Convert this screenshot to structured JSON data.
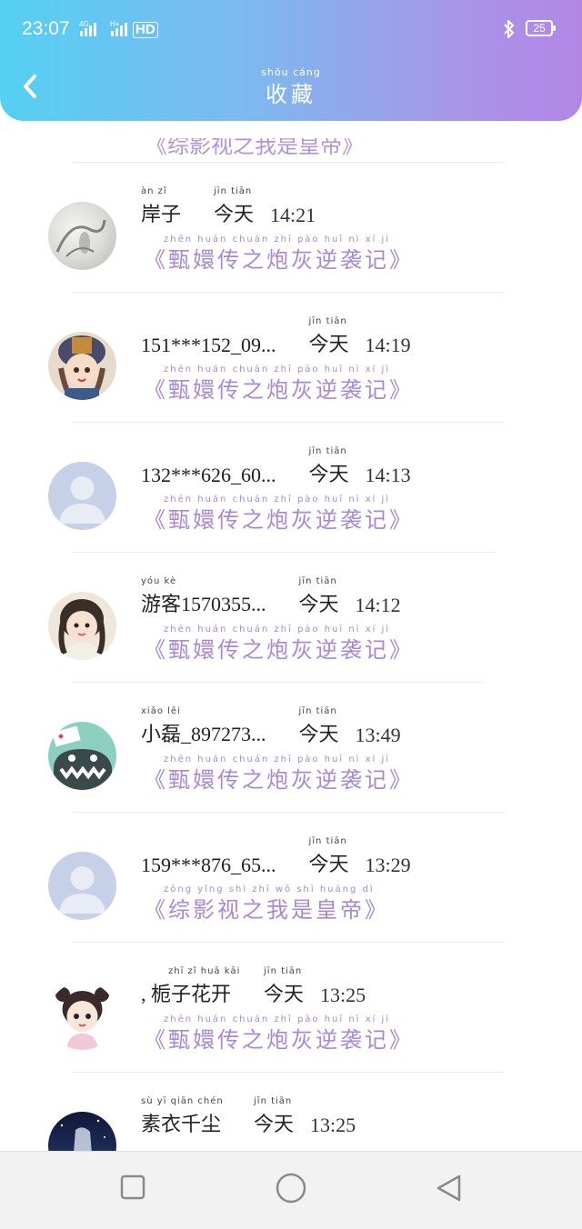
{
  "status_bar": {
    "time": "23:07",
    "net1": "4G",
    "net2": "H+",
    "hd": "HD",
    "battery": "25"
  },
  "header": {
    "title": "收藏",
    "title_pinyin": "shōu cáng"
  },
  "partial_row": {
    "book": "《综影视之我是皇帝》"
  },
  "rows": [
    {
      "name": "岸子",
      "name_pinyin": "àn zǐ",
      "today": "今天",
      "today_pinyin": "jīn tiān",
      "time": "14:21",
      "book": "《甄嬛传之炮灰逆袭记》",
      "book_pinyin": "zhēn huán chuán zhī pào huī nì xí jì"
    },
    {
      "name": "151***152_09...",
      "name_pinyin": "",
      "today": "今天",
      "today_pinyin": "jīn tiān",
      "time": "14:19",
      "book": "《甄嬛传之炮灰逆袭记》",
      "book_pinyin": "zhēn huán chuán zhī pào huī nì xí jì"
    },
    {
      "name": "132***626_60...",
      "name_pinyin": "",
      "today": "今天",
      "today_pinyin": "jīn tiān",
      "time": "14:13",
      "book": "《甄嬛传之炮灰逆袭记》",
      "book_pinyin": "zhēn huán chuán zhī pào huī nì xí jì"
    },
    {
      "name": "游客1570355...",
      "name_pinyin": "yóu kè",
      "today": "今天",
      "today_pinyin": "jīn tiān",
      "time": "14:12",
      "book": "《甄嬛传之炮灰逆袭记》",
      "book_pinyin": "zhēn huán chuán zhī pào huī nì xí jì"
    },
    {
      "name": "小磊_897273...",
      "name_pinyin": "xiǎo lěi",
      "today": "今天",
      "today_pinyin": "jīn tiān",
      "time": "13:49",
      "book": "《甄嬛传之炮灰逆袭记》",
      "book_pinyin": "zhēn huán chuán zhī pào huī nì xí jì"
    },
    {
      "name": "159***876_65...",
      "name_pinyin": "",
      "today": "今天",
      "today_pinyin": "jīn tiān",
      "time": "13:29",
      "book": "《综影视之我是皇帝》",
      "book_pinyin": "zōng yǐng shì zhī wǒ shì huáng dì"
    },
    {
      "name": ", 栀子花开",
      "name_pinyin": "zhī zǐ huā kāi",
      "today": "今天",
      "today_pinyin": "jīn tiān",
      "time": "13:25",
      "book": "《甄嬛传之炮灰逆袭记》",
      "book_pinyin": "zhēn huán chuán zhī pào huī nì xí jì"
    },
    {
      "name": "素衣千尘",
      "name_pinyin": "sù yī qiān chén",
      "today": "今天",
      "today_pinyin": "jīn tiān",
      "time": "13:25",
      "book": "",
      "book_pinyin": ""
    }
  ],
  "colors": {
    "accent": "#a889d4",
    "header_start": "#55d0f3",
    "header_end": "#b386e6"
  }
}
